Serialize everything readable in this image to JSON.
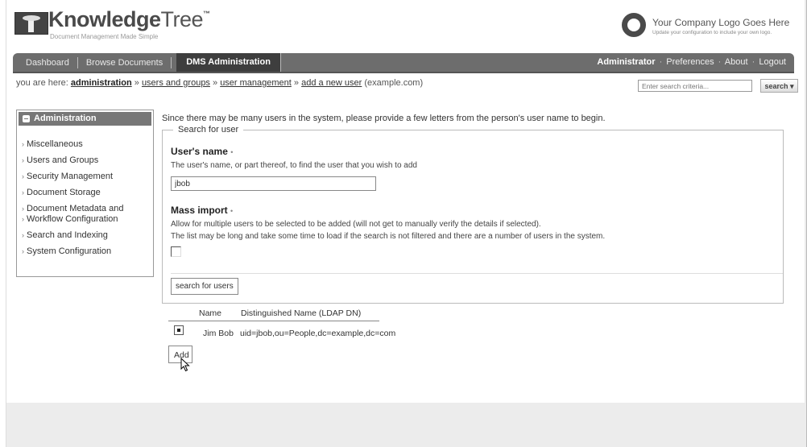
{
  "brand": {
    "name_bold": "Knowledge",
    "name_light": "Tree",
    "trademark": "™",
    "tagline": "Document Management Made Simple"
  },
  "company": {
    "title": "Your Company Logo Goes Here",
    "subtitle": "Update your configuration to include your own logo."
  },
  "nav": {
    "tabs": [
      {
        "label": "Dashboard"
      },
      {
        "label": "Browse Documents"
      },
      {
        "label": "DMS Administration",
        "active": true
      }
    ],
    "user": "Administrator",
    "links": [
      "Preferences",
      "About",
      "Logout"
    ],
    "link_sep": "·"
  },
  "breadcrumb": {
    "prefix": "you are here:",
    "items": [
      "administration",
      "users and groups",
      "user management",
      "add a new user"
    ],
    "sep": "»",
    "suffix": "(example.com)"
  },
  "search": {
    "placeholder": "Enter search criteria...",
    "button": "search",
    "button_arrow": "▾"
  },
  "sidebar": {
    "title": "Administration",
    "items": [
      {
        "label": "Miscellaneous"
      },
      {
        "label": "Users and Groups"
      },
      {
        "label": "Security Management"
      },
      {
        "label": "Document Storage"
      },
      {
        "label": "Document Metadata and"
      },
      {
        "label": "Workflow Configuration"
      },
      {
        "label": "Search and Indexing"
      },
      {
        "label": "System Configuration"
      }
    ]
  },
  "main": {
    "intro": "Since there may be many users in the system, please provide a few letters from the person's user name to begin.",
    "fieldset_legend": "Search for user",
    "username_label": "User's name",
    "required_mark": "•",
    "username_help": "The user's name, or part thereof, to find the user that you wish to add",
    "username_value": "jbob",
    "mass_label": "Mass import",
    "mass_help_1": "Allow for multiple users to be selected to be added (will not get to manually verify the details if selected).",
    "mass_help_2": "The list may be long and take some time to load if the search is not filtered and there are a number of users in the system.",
    "search_users_button": "search for users"
  },
  "results": {
    "headers": [
      "Name",
      "Distinguished Name (LDAP DN)"
    ],
    "rows": [
      {
        "name": "Jim Bob",
        "dn": "uid=jbob,ou=People,dc=example,dc=com"
      }
    ],
    "add_button": "Add"
  }
}
